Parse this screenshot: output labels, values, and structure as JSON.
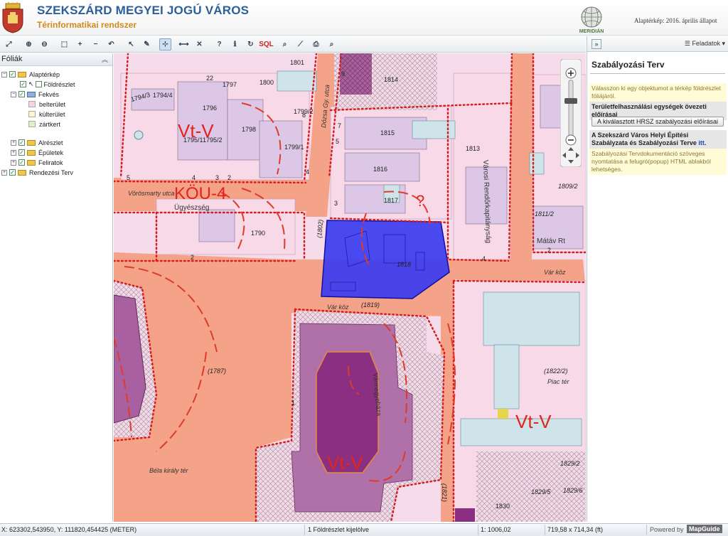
{
  "header": {
    "title": "SZEKSZÁRD MEGYEI JOGÚ VÁROS",
    "subtitle": "Térinformatikai rendszer",
    "logo_text": "MERIDIÁN",
    "basemap_state": "Alaptérkép: 2016. április állapot"
  },
  "toolbar": {
    "tools": [
      "full-extent-icon",
      "zoom-in-icon",
      "zoom-out-icon",
      "zoom-window-icon",
      "zoom-plus-icon",
      "zoom-minus-icon",
      "zoom-previous-icon",
      "select-arrow-icon",
      "select-pen-icon",
      "select-add-icon",
      "measure-icon",
      "clear-icon",
      "help-icon",
      "info-icon",
      "layers-refresh-icon",
      "sql-icon",
      "search-icon",
      "ruler-icon",
      "print-icon",
      "attributes-icon",
      "find-icon"
    ],
    "sql_label": "SQL"
  },
  "layers_panel": {
    "title": "Fóliák",
    "items": [
      {
        "label": "Alaptérkép"
      },
      {
        "label": "Földrészlet"
      },
      {
        "label": "Fekvés"
      },
      {
        "label": "belterület",
        "color": "#f7d3e6"
      },
      {
        "label": "külterület",
        "color": "#fff4cc"
      },
      {
        "label": "zártkert",
        "color": "#ddf0c8"
      },
      {
        "label": "Alrészlet"
      },
      {
        "label": "Épületek"
      },
      {
        "label": "Feliratok"
      },
      {
        "label": "Rendezési Terv"
      }
    ]
  },
  "right_panel": {
    "menu": "Feladatok",
    "title": "Szabályozási Terv",
    "note1": "Válasszon ki egy objektumot a térkép földrészlet fóliájáról.",
    "section1": "Területfelhasználási egységek övezeti előírásai",
    "button1": "A kiválasztott HRSZ szabályozási előírásai",
    "section2_pre": "A Szekszárd Város Helyi Építési Szabályzata és Szabályozási Terve ",
    "section2_link": "itt",
    "section2_post": ".",
    "note2": "Szabályozási Tervdokumentáció szöveges nyomtatása a felugró(popup) HTML ablakból lehetséges."
  },
  "map": {
    "zones": [
      "Vt-V",
      "KÖU-4",
      "Vt-V",
      "Vt-V"
    ],
    "streets": [
      "Vörösmarty utca",
      "Dózsa Gy. utca",
      "Városi Rendőrkapitányság",
      "Vár köz",
      "Vár köz",
      "Béla király tér",
      "Vármegyeháza",
      "Piac tér",
      "Ügyészség",
      "Mátáv Rt"
    ],
    "parcels": [
      "1801",
      "1800",
      "1797",
      "1796",
      "1794/3",
      "1794/4",
      "1798",
      "1799/2",
      "1799/1",
      "1795/1",
      "1795/2",
      "1814",
      "1815",
      "1816",
      "1817",
      "1813",
      "1818",
      "1790",
      "(1802)",
      "(1819)",
      "(1787)",
      "(1822/2)",
      "1809/2",
      "1811/2",
      "1829/2",
      "1829/5",
      "1829/6",
      "1830",
      "(1821)",
      "22",
      "5",
      "4",
      "3",
      "2",
      "2",
      "3",
      "5",
      "4",
      "7",
      "8",
      "1",
      "4",
      "2",
      "9"
    ],
    "question": "?"
  },
  "status": {
    "coords": "X: 623302,543950, Y: 111820,454425 (METER)",
    "selection": "1 Földrészlet kijelölve",
    "scale": "1: 1006,02",
    "extent": "719,58 x 714,34 (ft)",
    "powered": "Powered by",
    "brand": "MapGuide"
  }
}
